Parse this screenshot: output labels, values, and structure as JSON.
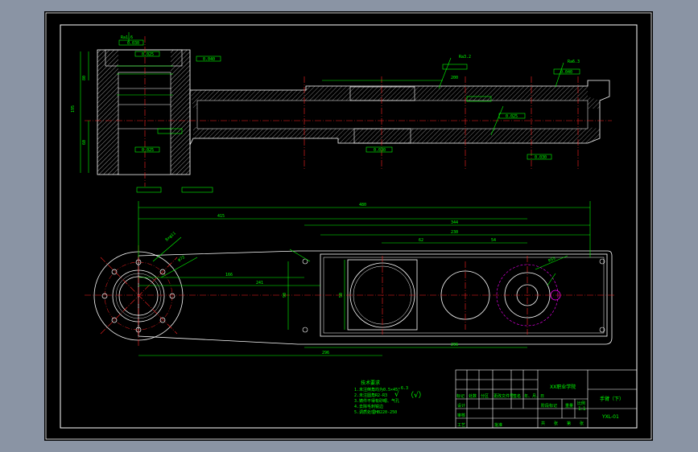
{
  "title_block": {
    "org": "XX职业学院",
    "part_name": "手臂（下）",
    "drawing_no": "YXL-01",
    "scale": "1:1",
    "row_labels": [
      "标记",
      "处数",
      "分区",
      "更改文件号",
      "签名",
      "年、月、日"
    ],
    "bottom_labels": [
      "设计",
      "审核",
      "工艺",
      "批准"
    ],
    "stage_labels": [
      "阶段标记",
      "重量",
      "比例"
    ],
    "sheet_labels": [
      "共",
      "张",
      "第",
      "张"
    ]
  },
  "notes": {
    "heading": "技术要求",
    "items": [
      "1.未注倒角均为0.5×45°",
      "2.未注圆角R2-R3",
      "3.铸件不得有砂眼、气孔",
      "4.去除毛刺锐边",
      "5.调质处理HB220-250"
    ]
  },
  "roughness": {
    "symbol_text": "√",
    "value": "6.3",
    "paren": "（√）"
  },
  "dimensions": {
    "d_top_overall": "480",
    "d_top_mid": "415",
    "d_top_right": "344",
    "d_inner_top": "230",
    "d_inner_a": "62",
    "d_inner_b": "54",
    "d_left": "166",
    "d_mid": "241",
    "d_bottom_wide": "296",
    "d_bottom_long": "296",
    "d_vert_h": "90",
    "d_vert_h2": "50",
    "d_side_height": "195",
    "d_side_a": "80",
    "d_side_b": "60",
    "d_section_len": "200",
    "d_pcd": "8×φ11",
    "d_bore": "φ72",
    "d_circ_r": "R55"
  },
  "tolerance_boxes": [
    "0.030",
    "0.025",
    "0.040",
    "0.025",
    "0.030",
    "0.040",
    "0.025",
    "0.030"
  ],
  "surface_marks": [
    "Ra1.6",
    "Ra3.2",
    "Ra6.3"
  ]
}
